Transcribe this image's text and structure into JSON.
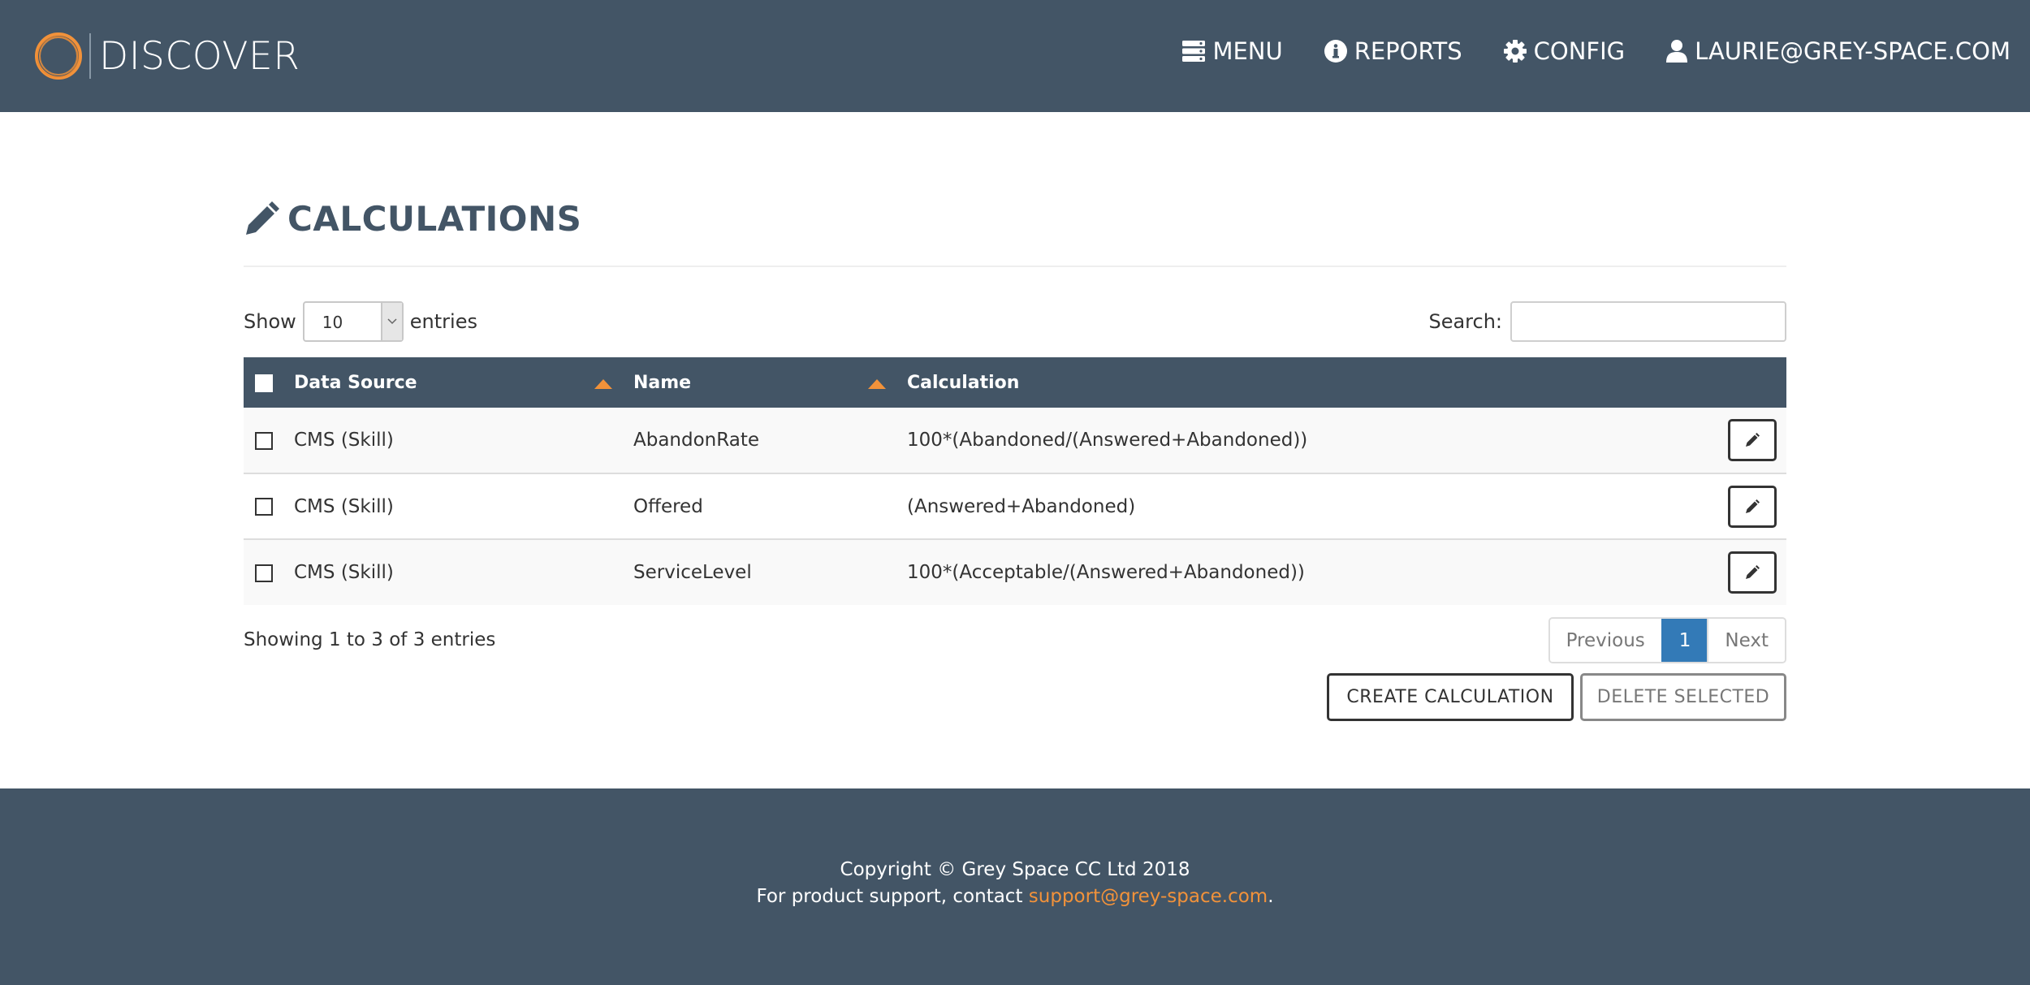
{
  "header": {
    "brand": "DISCOVER",
    "nav": [
      {
        "label": "MENU",
        "icon": "server-icon"
      },
      {
        "label": "REPORTS",
        "icon": "info-circle-icon"
      },
      {
        "label": "CONFIG",
        "icon": "gear-icon"
      },
      {
        "label": "LAURIE@GREY-SPACE.COM",
        "icon": "user-icon"
      }
    ]
  },
  "page": {
    "title": "CALCULATIONS",
    "title_icon": "pencil-icon"
  },
  "controls": {
    "show_label": "Show",
    "entries_value": "10",
    "entries_label": "entries",
    "search_label": "Search:",
    "search_value": ""
  },
  "table": {
    "columns": [
      "Data Source",
      "Name",
      "Calculation"
    ],
    "rows": [
      {
        "data_source": "CMS (Skill)",
        "name": "AbandonRate",
        "calculation": "100*(Abandoned/(Answered+Abandoned))"
      },
      {
        "data_source": "CMS (Skill)",
        "name": "Offered",
        "calculation": "(Answered+Abandoned)"
      },
      {
        "data_source": "CMS (Skill)",
        "name": "ServiceLevel",
        "calculation": "100*(Acceptable/(Answered+Abandoned))"
      }
    ]
  },
  "pagination": {
    "info": "Showing 1 to 3 of 3 entries",
    "previous": "Previous",
    "current": "1",
    "next": "Next"
  },
  "actions": {
    "create": "CREATE CALCULATION",
    "delete": "DELETE SELECTED"
  },
  "footer": {
    "copyright": "Copyright © Grey Space CC Ltd 2018",
    "support_prefix": "For product support, contact ",
    "support_email": "support@grey-space.com",
    "support_suffix": "."
  },
  "colors": {
    "header_bg": "#435566",
    "accent": "#f2923a",
    "page_link": "#337ab7"
  }
}
